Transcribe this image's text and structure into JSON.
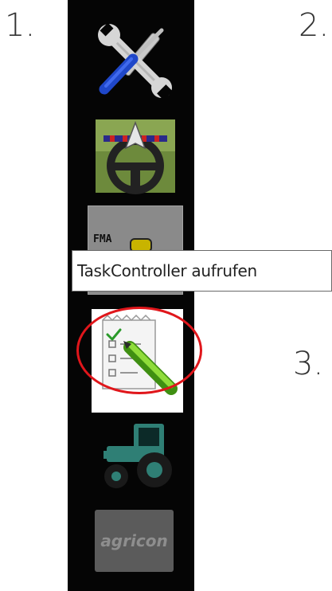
{
  "steps": {
    "one": "1.",
    "two": "2.",
    "three": "3."
  },
  "toolbar": {
    "items": [
      {
        "icon": "settings-tools-icon"
      },
      {
        "icon": "guidance-steering-icon"
      },
      {
        "icon": "fma-icon",
        "label": "FMA"
      },
      {
        "icon": "task-controller-icon"
      },
      {
        "icon": "tractor-icon"
      },
      {
        "icon": "agricon-logo",
        "label": "agricon"
      }
    ]
  },
  "tooltip": {
    "text": "TaskController aufrufen"
  },
  "colors": {
    "highlight": "#e0161b",
    "bar": "#050505",
    "tractor": "#2f7f75"
  }
}
